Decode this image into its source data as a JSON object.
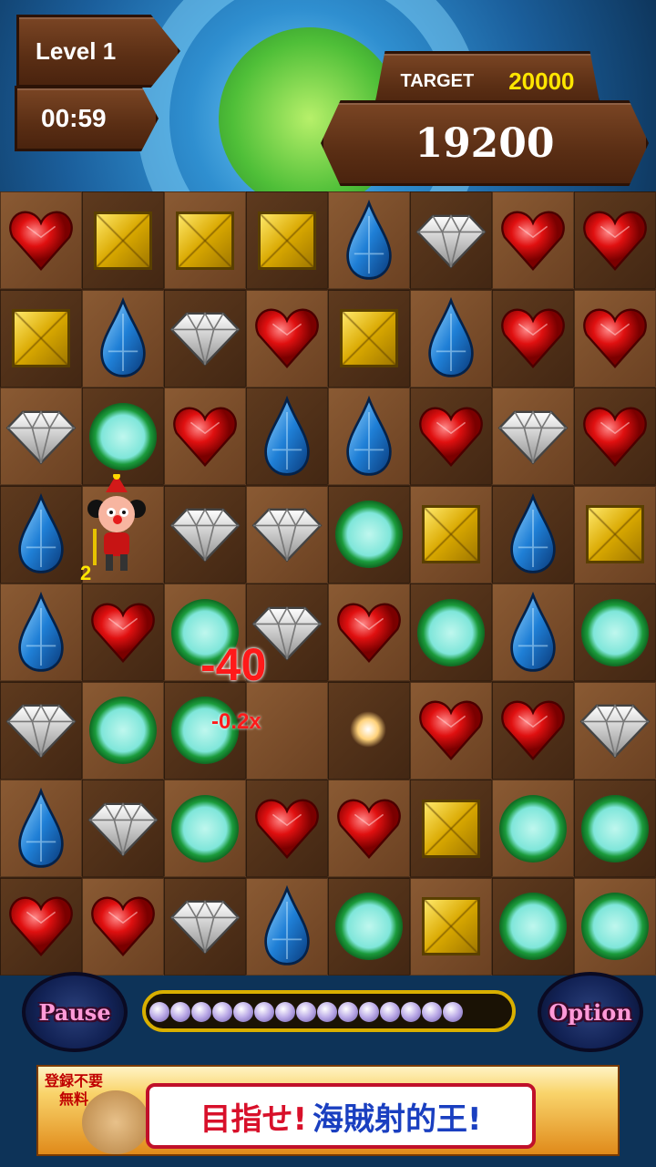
{
  "hud": {
    "level_label": "Level 1",
    "timer": "00:59",
    "target_label": "TARGET",
    "target_value": "20000",
    "score": "19200"
  },
  "board": {
    "rows": [
      [
        "ruby",
        "topaz",
        "topaz",
        "topaz",
        "sapphire",
        "diamond",
        "ruby",
        "ruby"
      ],
      [
        "topaz",
        "sapphire",
        "diamond",
        "ruby",
        "topaz",
        "sapphire",
        "ruby",
        "ruby"
      ],
      [
        "diamond",
        "emerald",
        "ruby",
        "sapphire",
        "sapphire",
        "ruby",
        "diamond",
        "ruby"
      ],
      [
        "sapphire",
        "clown",
        "diamond",
        "diamond",
        "emerald",
        "topaz",
        "sapphire",
        "topaz"
      ],
      [
        "sapphire",
        "ruby",
        "emerald",
        "diamond",
        "ruby",
        "emerald",
        "sapphire",
        "emerald"
      ],
      [
        "diamond",
        "emerald",
        "emerald",
        "empty",
        "sparkle",
        "ruby",
        "ruby",
        "diamond"
      ],
      [
        "sapphire",
        "diamond",
        "emerald",
        "ruby",
        "ruby",
        "topaz",
        "emerald",
        "emerald"
      ],
      [
        "ruby",
        "ruby",
        "diamond",
        "sapphire",
        "emerald",
        "topaz",
        "emerald",
        "emerald"
      ]
    ]
  },
  "effects": {
    "combo_count": "2",
    "score_popup": "-40",
    "multiplier_popup": "-0.2x"
  },
  "controls": {
    "pause_label": "Pause",
    "option_label": "Option",
    "gem_progress_filled": 15,
    "gem_progress_total": 16
  },
  "ad": {
    "badge_line1": "登録不要",
    "badge_line2": "無料",
    "title_part1": "目指せ!",
    "title_part2": "海賊射的王!"
  }
}
